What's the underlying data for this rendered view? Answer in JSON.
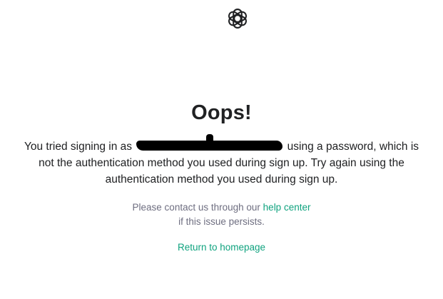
{
  "header": {
    "logo_icon": "openai-logo-icon"
  },
  "error": {
    "title": "Oops!",
    "message_prefix": "You tried signing in as",
    "message_suffix": "using a password, which is not the authentication method you used during sign up. Try again using the authentication method you used during sign up.",
    "contact_prefix": "Please contact us through our",
    "help_link": "help center",
    "contact_suffix": "if this issue persists.",
    "return_link": "Return to homepage"
  },
  "colors": {
    "text": "#202123",
    "muted": "#6e6e80",
    "accent": "#10a37f"
  }
}
